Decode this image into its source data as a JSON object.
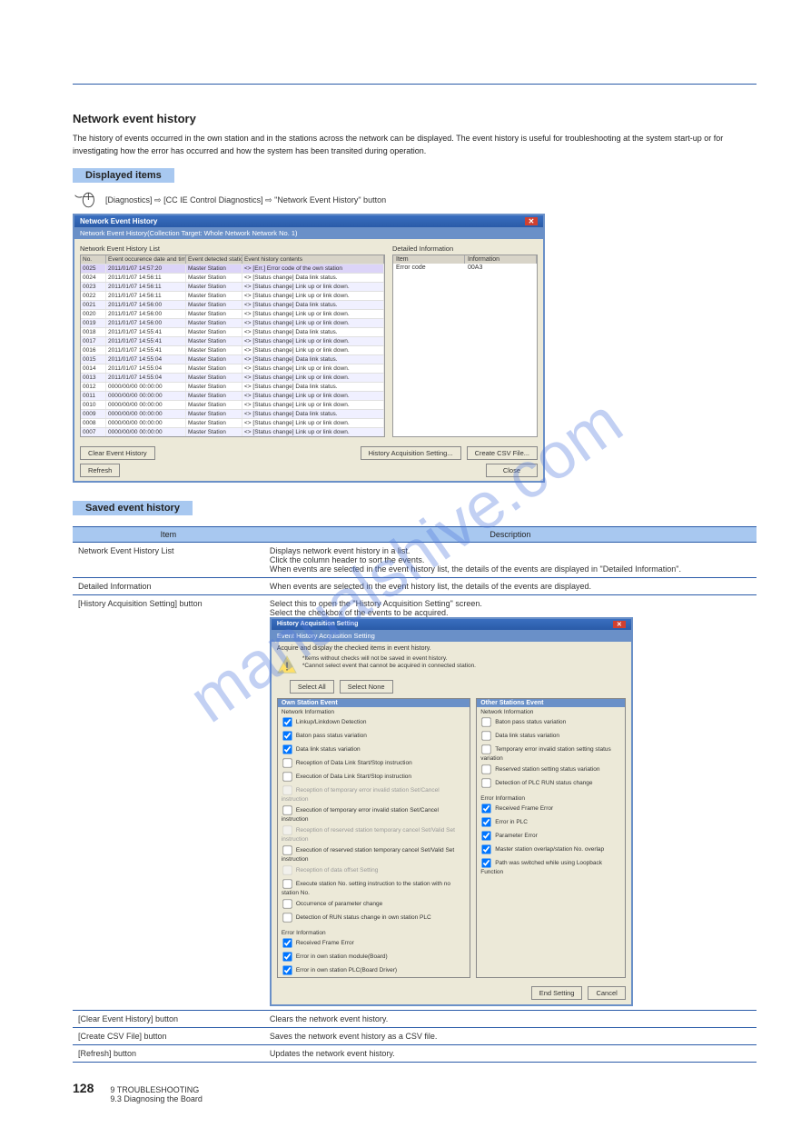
{
  "page": {
    "section_title": "Network event history",
    "section_text": "The history of events occurred in the own station and in the stations across the network can be displayed. The event history is useful for troubleshooting at the system start-up or for investigating how the error has occurred and how the system has been transited during operation.",
    "outline_title": "Displayed items",
    "outline_path": "[Diagnostics] ⇨ [CC IE Control Diagnostics] ⇨ \"Network Event History\" button",
    "save_title": "Saved event history",
    "footer_chapter": "9 TROUBLESHOOTING",
    "footer_section": "9.3 Diagnosing the Board",
    "footer_pagenum": "128"
  },
  "dialog1": {
    "title": "Network Event History",
    "subtitle": "Network Event History(Collection Target: Whole Network  Network No. 1)",
    "list_label": "Network Event History List",
    "headers": {
      "no": "No.",
      "dt": "Event occurence date and time",
      "st": "Event detected station",
      "ct": "Event history contents"
    },
    "rows": [
      {
        "no": "0025",
        "dt": "2011/01/07 14:57:20",
        "st": "Master Station",
        "ct": "<<Own St.>> [Err.] Error code of the own station"
      },
      {
        "no": "0024",
        "dt": "2011/01/07 14:56:11",
        "st": "Master Station",
        "ct": "<<Own St.>> [Status change] Data link status."
      },
      {
        "no": "0023",
        "dt": "2011/01/07 14:56:11",
        "st": "Master Station",
        "ct": "<<Own St.>> [Status change] Link up or link down."
      },
      {
        "no": "0022",
        "dt": "2011/01/07 14:56:11",
        "st": "Master Station",
        "ct": "<<Own St.>> [Status change] Link up or link down."
      },
      {
        "no": "0021",
        "dt": "2011/01/07 14:56:00",
        "st": "Master Station",
        "ct": "<<Own St.>> [Status change] Data link status."
      },
      {
        "no": "0020",
        "dt": "2011/01/07 14:56:00",
        "st": "Master Station",
        "ct": "<<Own St.>> [Status change] Link up or link down."
      },
      {
        "no": "0019",
        "dt": "2011/01/07 14:56:00",
        "st": "Master Station",
        "ct": "<<Own St.>> [Status change] Link up or link down."
      },
      {
        "no": "0018",
        "dt": "2011/01/07 14:55:41",
        "st": "Master Station",
        "ct": "<<Own St.>> [Status change] Data link status."
      },
      {
        "no": "0017",
        "dt": "2011/01/07 14:55:41",
        "st": "Master Station",
        "ct": "<<Own St.>> [Status change] Link up or link down."
      },
      {
        "no": "0016",
        "dt": "2011/01/07 14:55:41",
        "st": "Master Station",
        "ct": "<<Own St.>> [Status change] Link up or link down."
      },
      {
        "no": "0015",
        "dt": "2011/01/07 14:55:04",
        "st": "Master Station",
        "ct": "<<Own St.>> [Status change] Data link status."
      },
      {
        "no": "0014",
        "dt": "2011/01/07 14:55:04",
        "st": "Master Station",
        "ct": "<<Own St.>> [Status change] Link up or link down."
      },
      {
        "no": "0013",
        "dt": "2011/01/07 14:55:04",
        "st": "Master Station",
        "ct": "<<Own St.>> [Status change] Link up or link down."
      },
      {
        "no": "0012",
        "dt": "0000/00/00 00:00:00",
        "st": "Master Station",
        "ct": "<<Own St.>> [Status change] Data link status."
      },
      {
        "no": "0011",
        "dt": "0000/00/00 00:00:00",
        "st": "Master Station",
        "ct": "<<Own St.>> [Status change] Link up or link down."
      },
      {
        "no": "0010",
        "dt": "0000/00/00 00:00:00",
        "st": "Master Station",
        "ct": "<<Own St.>> [Status change] Link up or link down."
      },
      {
        "no": "0009",
        "dt": "0000/00/00 00:00:00",
        "st": "Master Station",
        "ct": "<<Own St.>> [Status change] Data link status."
      },
      {
        "no": "0008",
        "dt": "0000/00/00 00:00:00",
        "st": "Master Station",
        "ct": "<<Own St.>> [Status change] Link up or link down."
      },
      {
        "no": "0007",
        "dt": "0000/00/00 00:00:00",
        "st": "Master Station",
        "ct": "<<Own St.>> [Status change] Link up or link down."
      }
    ],
    "detail_label": "Detailed Information",
    "detail_headers": {
      "item": "Item",
      "info": "Information"
    },
    "detail_row": {
      "item": "Error code",
      "info": "00A3"
    },
    "buttons": {
      "clear": "Clear Event History",
      "refresh": "Refresh",
      "acq": "History Acquisition Setting...",
      "csv": "Create CSV File...",
      "close": "Close"
    }
  },
  "desc_table": {
    "head_item": "Item",
    "head_desc": "Description",
    "rows": [
      {
        "item": "Network Event History List",
        "desc_lines": [
          "Displays network event history in a list.",
          "Click the column header to sort the events.",
          "When events are selected in the event history list, the details of the events are displayed in \"Detailed Information\"."
        ]
      },
      {
        "item": "Detailed Information",
        "desc": "When events are selected in the event history list, the details of the events are displayed."
      },
      {
        "item": "[History Acquisition Setting] button",
        "desc_lines": [
          "Select this to open the \"History Acquisition Setting\" screen.",
          "Select the checkbox of the events to be acquired."
        ]
      },
      {
        "item": "[Clear Event History] button",
        "desc": "Clears the network event history."
      },
      {
        "item": "[Create CSV File] button",
        "desc": "Saves the network event history as a CSV file."
      },
      {
        "item": "[Refresh] button",
        "desc": "Updates the network event history."
      }
    ]
  },
  "dialog2": {
    "title": "History Acquisition Setting",
    "subtitle": "Event History Acquisition Setting",
    "intro": "Acquire and display the checked items in event history.",
    "warn1": "*Items without checks will not be saved in event history.",
    "warn2": "*Cannot select event that cannot be acquired in connected station.",
    "btn_all": "Select All",
    "btn_none": "Select None",
    "group_own": "Own Station Event",
    "group_other": "Other Stations Event",
    "sub_net": "Network Information",
    "sub_err": "Error Information",
    "own_net": [
      {
        "label": "Linkup/Linkdown Detection",
        "checked": true
      },
      {
        "label": "Baton pass status variation",
        "checked": true
      },
      {
        "label": "Data link status variation",
        "checked": true
      },
      {
        "label": "Reception of Data Link Start/Stop instruction",
        "checked": false
      },
      {
        "label": "Execution of Data Link Start/Stop instruction",
        "checked": false
      },
      {
        "label": "Reception of temporary error invalid station Set/Cancel instruction",
        "checked": false,
        "dim": true
      },
      {
        "label": "Execution of temporary error invalid station Set/Cancel instruction",
        "checked": false
      },
      {
        "label": "Reception of reserved station temporary cancel Set/Valid Set instruction",
        "checked": false,
        "dim": true
      },
      {
        "label": "Execution of reserved station temporary cancel Set/Valid Set instruction",
        "checked": false
      },
      {
        "label": "Reception of data offset Setting",
        "checked": false,
        "dim": true
      },
      {
        "label": "Execute station No. setting instruction to the station with no station No.",
        "checked": false
      },
      {
        "label": "Occurrence of parameter change",
        "checked": false
      },
      {
        "label": "Detection of RUN status change in own station PLC",
        "checked": false
      }
    ],
    "own_err": [
      {
        "label": "Received Frame Error",
        "checked": true
      },
      {
        "label": "Error in own station module(Board)",
        "checked": true
      },
      {
        "label": "Error in own station PLC(Board Driver)",
        "checked": true
      }
    ],
    "other_net": [
      {
        "label": "Baton pass status variation",
        "checked": false
      },
      {
        "label": "Data link status variation",
        "checked": false
      },
      {
        "label": "Temporary error invalid station setting status variation",
        "checked": false
      },
      {
        "label": "Reserved station setting status variation",
        "checked": false
      },
      {
        "label": "Detection of PLC RUN status change",
        "checked": false
      }
    ],
    "other_err": [
      {
        "label": "Received Frame Error",
        "checked": true
      },
      {
        "label": "Error in PLC",
        "checked": true
      },
      {
        "label": "Parameter Error",
        "checked": true
      },
      {
        "label": "Master station overlap/station No. overlap",
        "checked": true
      },
      {
        "label": "Path was switched while using Loopback Function",
        "checked": true
      }
    ],
    "btn_end": "End Setting",
    "btn_cancel": "Cancel"
  }
}
